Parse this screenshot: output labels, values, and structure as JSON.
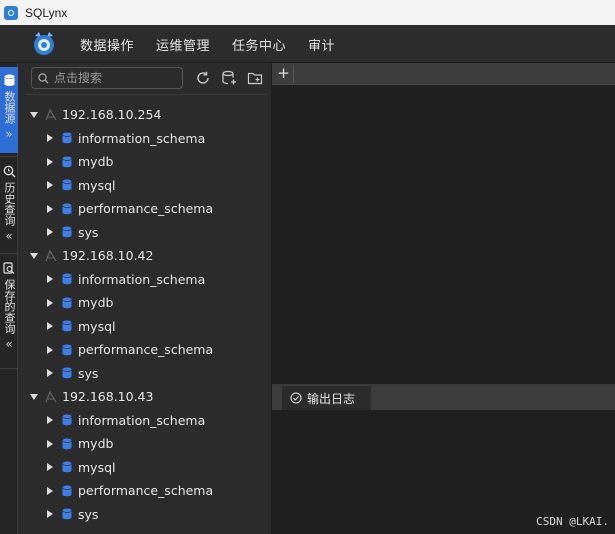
{
  "window": {
    "title": "SQLynx"
  },
  "menu": [
    {
      "label": "数据操作"
    },
    {
      "label": "运维管理"
    },
    {
      "label": "任务中心"
    },
    {
      "label": "审计"
    }
  ],
  "activity": [
    {
      "label": "数据源",
      "icon": "database-icon",
      "active": true,
      "chevron": "»"
    },
    {
      "label": "历史查询",
      "icon": "history-search-icon",
      "active": false,
      "chevron": "«"
    },
    {
      "label": "保存的查询",
      "icon": "saved-query-icon",
      "active": false,
      "chevron": "«"
    }
  ],
  "search": {
    "placeholder": "点击搜索"
  },
  "tree": {
    "servers": [
      {
        "host": "192.168.10.254",
        "databases": [
          "information_schema",
          "mydb",
          "mysql",
          "performance_schema",
          "sys"
        ]
      },
      {
        "host": "192.168.10.42",
        "databases": [
          "information_schema",
          "mydb",
          "mysql",
          "performance_schema",
          "sys"
        ]
      },
      {
        "host": "192.168.10.43",
        "databases": [
          "information_schema",
          "mydb",
          "mysql",
          "performance_schema",
          "sys"
        ]
      }
    ]
  },
  "editor": {
    "add_tab": "+"
  },
  "output": {
    "tab_label": "输出日志"
  },
  "watermark": "CSDN @LKAI.",
  "colors": {
    "accent": "#2e6cd6",
    "db_icon": "#3d7ee8"
  }
}
